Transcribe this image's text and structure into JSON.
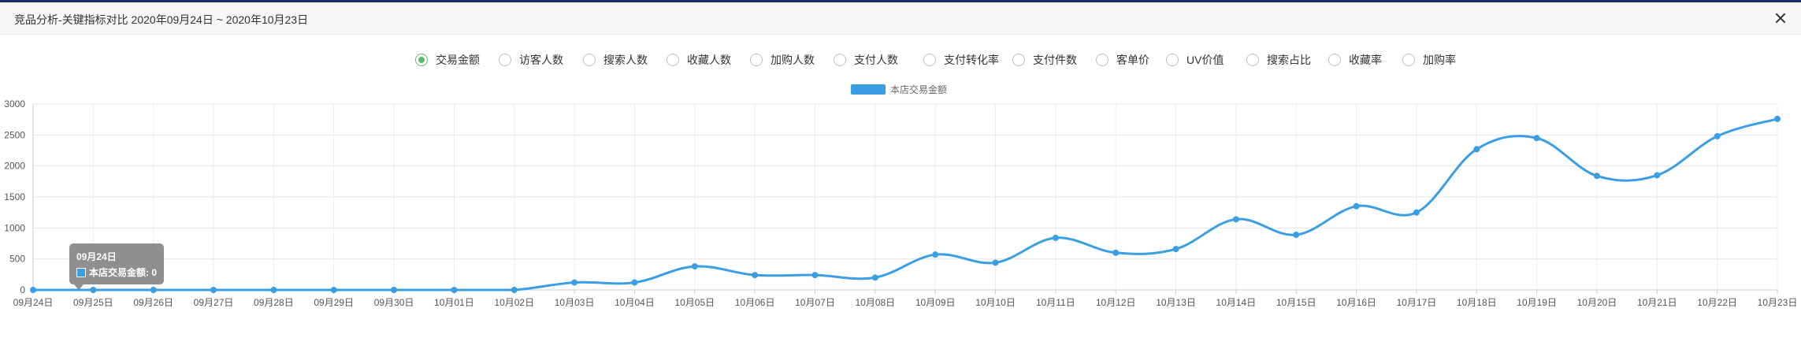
{
  "window": {
    "title": "竞品分析-关键指标对比 2020年09月24日 ~ 2020年10月23日"
  },
  "metrics": [
    {
      "label": "交易金额",
      "selected": true
    },
    {
      "label": "访客人数",
      "selected": false
    },
    {
      "label": "搜索人数",
      "selected": false
    },
    {
      "label": "收藏人数",
      "selected": false
    },
    {
      "label": "加购人数",
      "selected": false
    },
    {
      "label": "支付人数",
      "selected": false
    },
    {
      "label": "支付转化率",
      "selected": false
    },
    {
      "label": "支付件数",
      "selected": false
    },
    {
      "label": "客单价",
      "selected": false
    },
    {
      "label": "UV价值",
      "selected": false
    },
    {
      "label": "搜索占比",
      "selected": false
    },
    {
      "label": "收藏率",
      "selected": false
    },
    {
      "label": "加购率",
      "selected": false
    }
  ],
  "colors": {
    "series": "#3a9ee4",
    "selected_radio": "#5fb878"
  },
  "tooltip": {
    "title": "09月24日",
    "row": "本店交易金额: 0"
  },
  "chart_data": {
    "type": "line",
    "smooth": true,
    "grid": true,
    "legend": "top-center",
    "ylim": [
      0,
      3000
    ],
    "yticks": [
      0,
      500,
      1000,
      1500,
      2000,
      2500,
      3000
    ],
    "categories": [
      "09月24日",
      "09月25日",
      "09月26日",
      "09月27日",
      "09月28日",
      "09月29日",
      "09月30日",
      "10月01日",
      "10月02日",
      "10月03日",
      "10月04日",
      "10月05日",
      "10月06日",
      "10月07日",
      "10月08日",
      "10月09日",
      "10月10日",
      "10月11日",
      "10月12日",
      "10月13日",
      "10月14日",
      "10月15日",
      "10月16日",
      "10月17日",
      "10月18日",
      "10月19日",
      "10月20日",
      "10月21日",
      "10月22日",
      "10月23日"
    ],
    "series": [
      {
        "name": "本店交易金额",
        "values": [
          0,
          0,
          0,
          0,
          0,
          0,
          0,
          0,
          0,
          120,
          120,
          380,
          240,
          240,
          200,
          570,
          440,
          840,
          600,
          660,
          1140,
          890,
          1350,
          1250,
          2270,
          2450,
          1840,
          1850,
          2480,
          2760
        ]
      }
    ]
  }
}
